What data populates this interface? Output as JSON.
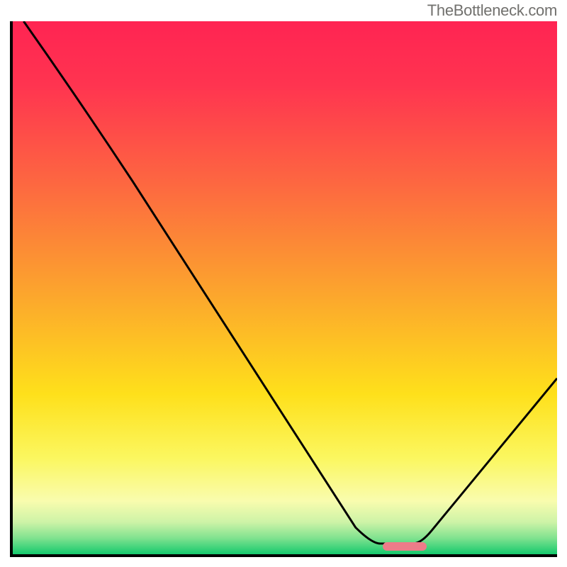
{
  "attribution": "TheBottleneck.com",
  "chart_data": {
    "type": "line",
    "title": "",
    "xlabel": "",
    "ylabel": "",
    "x_axis_visible_range": [
      0,
      100
    ],
    "y_axis_visible_range": [
      0,
      100
    ],
    "series": [
      {
        "name": "bottleneck-curve",
        "points": [
          {
            "x": 2,
            "y": 100
          },
          {
            "x": 22,
            "y": 70
          },
          {
            "x": 66,
            "y": 2
          },
          {
            "x": 75,
            "y": 2
          },
          {
            "x": 100,
            "y": 33
          }
        ],
        "note": "piecewise curve; segment 0→1 and transitions slightly rounded, minimum plateau between x≈66 and x≈75"
      }
    ],
    "optimal_marker": {
      "x_start": 68,
      "x_end": 76,
      "y": 1.5
    },
    "background_gradient_stops": [
      {
        "offset": 0.0,
        "color": "#ff2452"
      },
      {
        "offset": 0.12,
        "color": "#ff3450"
      },
      {
        "offset": 0.3,
        "color": "#fd6641"
      },
      {
        "offset": 0.5,
        "color": "#fca22e"
      },
      {
        "offset": 0.7,
        "color": "#fee01b"
      },
      {
        "offset": 0.82,
        "color": "#fbf760"
      },
      {
        "offset": 0.9,
        "color": "#f9fcae"
      },
      {
        "offset": 0.94,
        "color": "#cdf3a7"
      },
      {
        "offset": 0.97,
        "color": "#7fe28f"
      },
      {
        "offset": 1.0,
        "color": "#15c96d"
      }
    ]
  }
}
